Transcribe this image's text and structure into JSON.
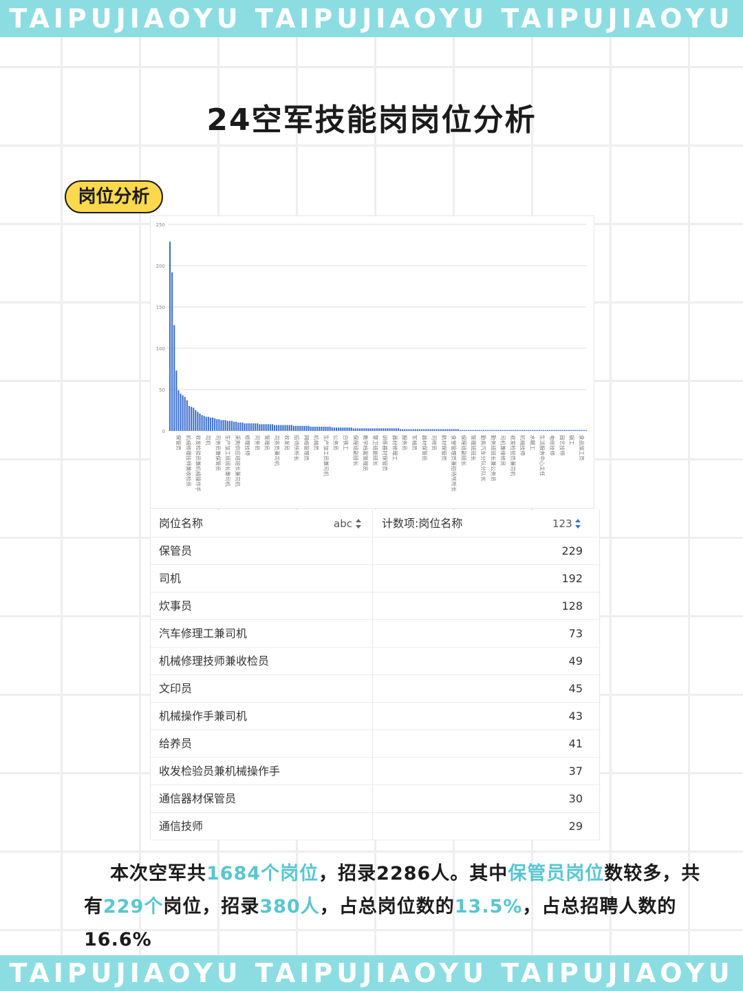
{
  "banner": {
    "text": "TAIPUJIAOYU TAIPUJIAOYU TAIPUJIAOYU"
  },
  "title": "24空军技能岗岗位分析",
  "section_label": "岗位分析",
  "colors": {
    "banner": "#8cdde2",
    "badge": "#fcd84c",
    "bar": "#3c6fd0",
    "highlight": "#58c6cf"
  },
  "chart_data": {
    "type": "bar",
    "yticks": [
      "250",
      "200",
      "150",
      "100",
      "50",
      "0"
    ],
    "ylim": [
      0,
      250
    ],
    "grid": true,
    "values": [
      229,
      192,
      128,
      73,
      49,
      45,
      43,
      41,
      37,
      30,
      29,
      28,
      25,
      23,
      21,
      19,
      18,
      17,
      17,
      16,
      16,
      15,
      14,
      14,
      13,
      13,
      13,
      12,
      12,
      12,
      11,
      11,
      10,
      10,
      10,
      9,
      9,
      9,
      9,
      9,
      9,
      9,
      8,
      8,
      8,
      8,
      8,
      8,
      8,
      7,
      7,
      7,
      7,
      7,
      7,
      7,
      7,
      7,
      6,
      6,
      6,
      6,
      6,
      6,
      6,
      6,
      5,
      5,
      5,
      5,
      5,
      5,
      5,
      5,
      5,
      5,
      4,
      4,
      4,
      4,
      4,
      4,
      4,
      4,
      4,
      4,
      3,
      3,
      3,
      3,
      3,
      3,
      3,
      3,
      3,
      3,
      3,
      3,
      3,
      3,
      3,
      3,
      3,
      3,
      3,
      3,
      3,
      3,
      2,
      2,
      2,
      2,
      2,
      2,
      2,
      2,
      2,
      2,
      2,
      2,
      2,
      2,
      2,
      2,
      2,
      2,
      2,
      2,
      2,
      2,
      2,
      2,
      2,
      2,
      2,
      2,
      1,
      1,
      1,
      1,
      1,
      1,
      1,
      1,
      1,
      1,
      1,
      1,
      1,
      1,
      1,
      1,
      1,
      1,
      1,
      1,
      1,
      1,
      1,
      1,
      1,
      1,
      1,
      1,
      1,
      1,
      1,
      1,
      1,
      1,
      1,
      1,
      1,
      1,
      1,
      1,
      1,
      1,
      1,
      1,
      1,
      1,
      1,
      1,
      1,
      1,
      1,
      1,
      1,
      1,
      1,
      1,
      1,
      1,
      1,
      1
    ],
    "x_labels": [
      "保管员",
      "机械修理技师兼收检员",
      "收发检验员兼机械操作手",
      "司机",
      "司务员兼保管员",
      "生产加工班班长兼司机",
      "采购供应班班长兼司机",
      "修理技师",
      "司务员",
      "管理员",
      "司务员兼司机",
      "收发员",
      "招待所所长",
      "网络管理员",
      "机械员",
      "生产加工员兼司机",
      "公务员",
      "白铁工",
      "保障班副班长",
      "教学档案管理员",
      "警卫班副班长",
      "训练器材保管员",
      "器材修理工",
      "服务员",
      "军械员",
      "器材保管员",
      "司修员",
      "航材保管员",
      "食堂管理员兼招待所所长",
      "保障班副班长",
      "管理班班长",
      "勤务汽车分队分队长",
      "勤务班班长兼公务员",
      "司机兼维修员",
      "收发检验员兼司机",
      "机械技师",
      "水暖工",
      "生活服务中心主任",
      "电修技师",
      "园艺技师",
      "锅工",
      "食品加工员"
    ]
  },
  "table": {
    "col_name_label": "岗位名称",
    "col_name_type": "abc",
    "col_count_label": "计数项:岗位名称",
    "col_count_type": "123",
    "rows": [
      {
        "name": "保管员",
        "count": "229"
      },
      {
        "name": "司机",
        "count": "192"
      },
      {
        "name": "炊事员",
        "count": "128"
      },
      {
        "name": "汽车修理工兼司机",
        "count": "73"
      },
      {
        "name": "机械修理技师兼收检员",
        "count": "49"
      },
      {
        "name": "文印员",
        "count": "45"
      },
      {
        "name": "机械操作手兼司机",
        "count": "43"
      },
      {
        "name": "给养员",
        "count": "41"
      },
      {
        "name": "收发检验员兼机械操作手",
        "count": "37"
      },
      {
        "name": "通信器材保管员",
        "count": "30"
      },
      {
        "name": "通信技师",
        "count": "29"
      }
    ]
  },
  "summary": {
    "p1": "本次空军共",
    "h1": "1684个岗位",
    "p2": "，招录2286人。其中",
    "h2": "保管员岗位",
    "p3": "数较多，共有",
    "h3": "229个",
    "p4": "岗位，招录",
    "h4": "380人",
    "p5": "，占总岗位数的",
    "h5": "13.5%",
    "p6": "，占总招聘人数的16.6%"
  }
}
